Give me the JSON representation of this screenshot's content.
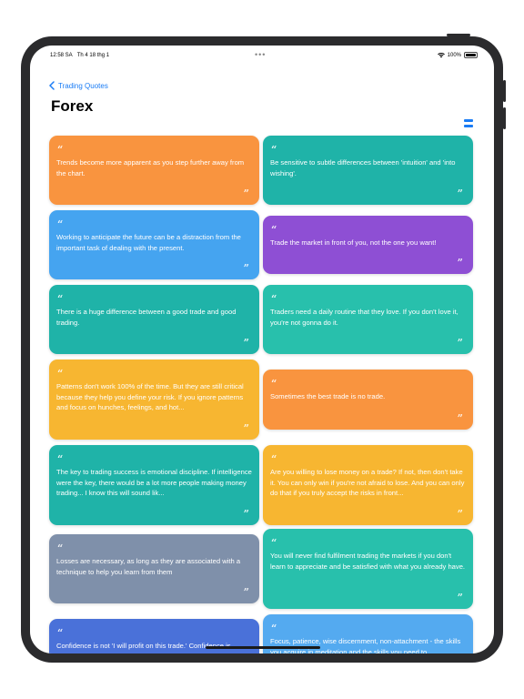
{
  "status": {
    "time": "12:58 SA",
    "date": "Th 4 18 thg 1",
    "battery": "100%",
    "battery_level": 1.0
  },
  "nav": {
    "back_label": "Trading Quotes"
  },
  "page": {
    "title": "Forex"
  },
  "colors": {
    "orange": "#f9943f",
    "teal": "#1fb3a8",
    "blue": "#45a4f0",
    "purple": "#8e4fd4",
    "green": "#28c0ac",
    "yellow": "#f7b631",
    "gray": "#7f90aa",
    "navy": "#4a71d9",
    "sky": "#54aaf0",
    "accent": "#1a7cf5"
  },
  "quotes": [
    {
      "text": "Trends become more apparent as you step further away from the chart.",
      "color": "orange"
    },
    {
      "text": "Be sensitive to subtle differences between 'intuition' and 'into wishing'.",
      "color": "teal"
    },
    {
      "text": "Working to anticipate the future can be a distraction from the important task of dealing with the present.",
      "color": "blue"
    },
    {
      "text": "Trade the market in front of you, not the one you want!",
      "color": "purple"
    },
    {
      "text": "There is a huge difference between a good trade and good trading.",
      "color": "teal"
    },
    {
      "text": "Traders need a daily routine that they love. If you don't love it, you're not gonna do it.",
      "color": "green"
    },
    {
      "text": "Patterns don't work 100% of the time. But they are still critical because they help you define your risk. If you ignore patterns and focus on hunches, feelings, and hot...",
      "color": "yellow"
    },
    {
      "text": "Sometimes the best trade is no trade.",
      "color": "orange"
    },
    {
      "text": "The key to trading success is emotional discipline. If intelligence were the key, there would be a lot more people making money trading... I know this will sound lik...",
      "color": "teal"
    },
    {
      "text": "Are you willing to lose money on a trade? If not, then don't take it. You can only win if you're not afraid to lose. And you can only do that if you truly accept the risks in front...",
      "color": "yellow"
    },
    {
      "text": "Losses are necessary, as long as they are associated with a technique to help you learn from them",
      "color": "gray"
    },
    {
      "text": "You will never find fulfilment trading the markets if you don't learn to appreciate and be satisfied with what you already have.",
      "color": "green"
    },
    {
      "text": "Confidence is not 'I will profit on this trade.' Confidence is...",
      "color": "navy"
    },
    {
      "text": "Focus, patience, wise discernment, non-attachment - the skills you acquire in meditation and the skills you need to...",
      "color": "sky"
    }
  ]
}
